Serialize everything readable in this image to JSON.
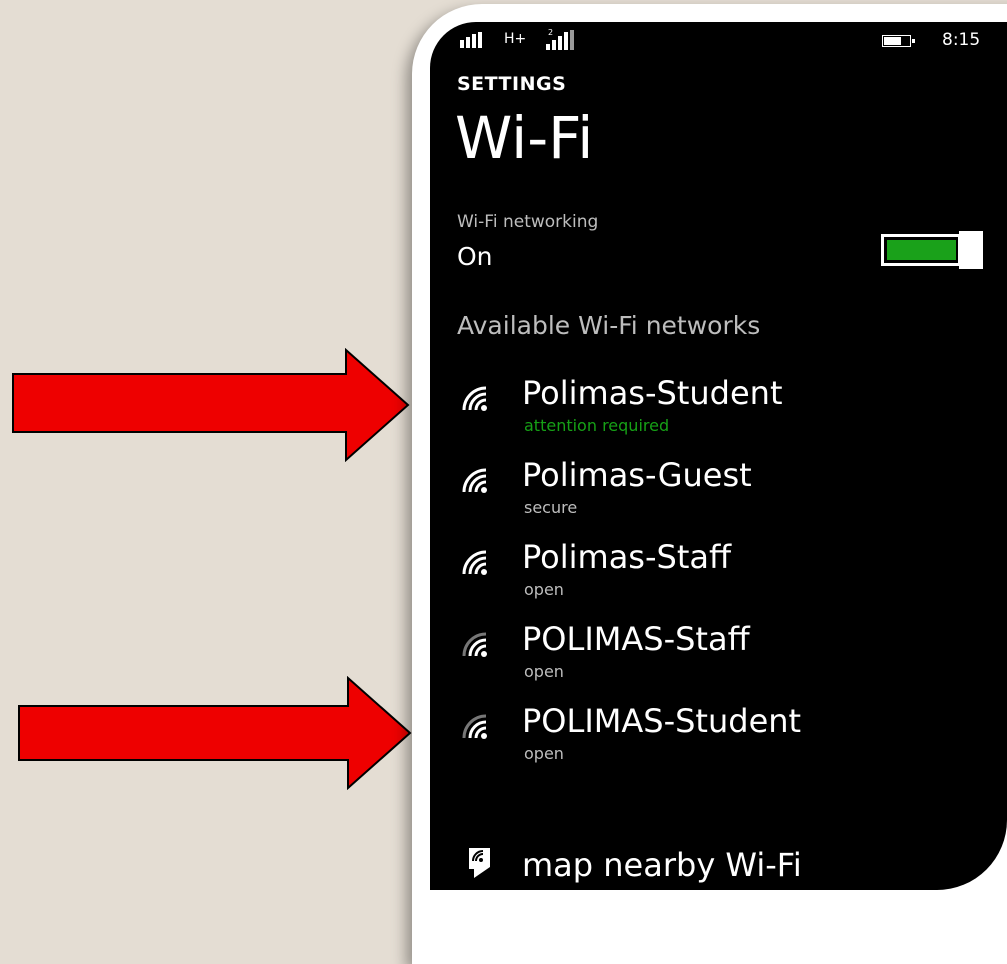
{
  "status_bar": {
    "network_type": "H+",
    "time": "8:15"
  },
  "header": {
    "section": "SETTINGS",
    "title": "Wi-Fi"
  },
  "wifi_toggle": {
    "label": "Wi-Fi networking",
    "value": "On",
    "accent_color": "#1aa11a"
  },
  "networks": {
    "title": "Available Wi-Fi networks",
    "items": [
      {
        "name": "Polimas-Student",
        "status": "attention required",
        "signal_icon": "wifi-signal-icon"
      },
      {
        "name": "Polimas-Guest",
        "status": "secure",
        "signal_icon": "wifi-signal-icon"
      },
      {
        "name": "Polimas-Staff",
        "status": "open",
        "signal_icon": "wifi-signal-icon"
      },
      {
        "name": "POLIMAS-Staff",
        "status": "open",
        "signal_icon": "wifi-signal-weak-icon"
      },
      {
        "name": "POLIMAS-Student",
        "status": "open",
        "signal_icon": "wifi-signal-weak-icon"
      }
    ]
  },
  "map_action": {
    "label": "map nearby Wi-Fi",
    "icon": "map-pin-icon"
  },
  "annotations": {
    "arrow_color": "#ee0000",
    "arrow_count": 2
  }
}
